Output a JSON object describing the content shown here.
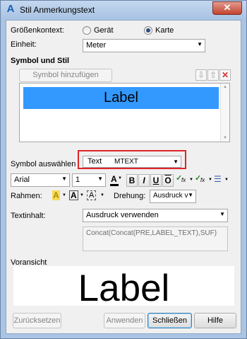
{
  "window": {
    "title": "Stil Anmerkungstext",
    "close_glyph": "✕",
    "app_icon": "A"
  },
  "size_context": {
    "label": "Größenkontext:",
    "option_device": "Gerät",
    "option_map": "Karte",
    "selected": "Karte"
  },
  "unit": {
    "label": "Einheit:",
    "value": "Meter"
  },
  "symbol_style": {
    "heading": "Symbol und Stil",
    "add_button": "Symbol hinzufügen",
    "list_items": [
      "Label"
    ],
    "selected_item": "Label"
  },
  "select_symbol": {
    "label": "Symbol auswählen",
    "type_text": "Text",
    "value": "MTEXT"
  },
  "font": {
    "family": "Arial",
    "size": "1",
    "bold_glyph": "B",
    "italic_glyph": "I",
    "underline_glyph": "U",
    "overline_glyph": "O",
    "fx1": "fx",
    "fx2": "fx"
  },
  "frame": {
    "label": "Rahmen:",
    "rotation_label": "Drehung:",
    "rotation_value": "Ausdruck v"
  },
  "text_content": {
    "label": "Textinhalt:",
    "value": "Ausdruck verwenden",
    "expression": "Concat(Concat(PRE,LABEL_TEXT),SUF)"
  },
  "preview": {
    "label": "Voransicht",
    "text": "Label"
  },
  "buttons": {
    "reset": "Zurücksetzen",
    "apply": "Anwenden",
    "close": "Schließen",
    "help": "Hilfe"
  },
  "colors": {
    "highlight": "#3399ff",
    "callout_border": "#e0252a",
    "delete_icon": "#d83333",
    "color_bar_red": "#e33c2c"
  }
}
